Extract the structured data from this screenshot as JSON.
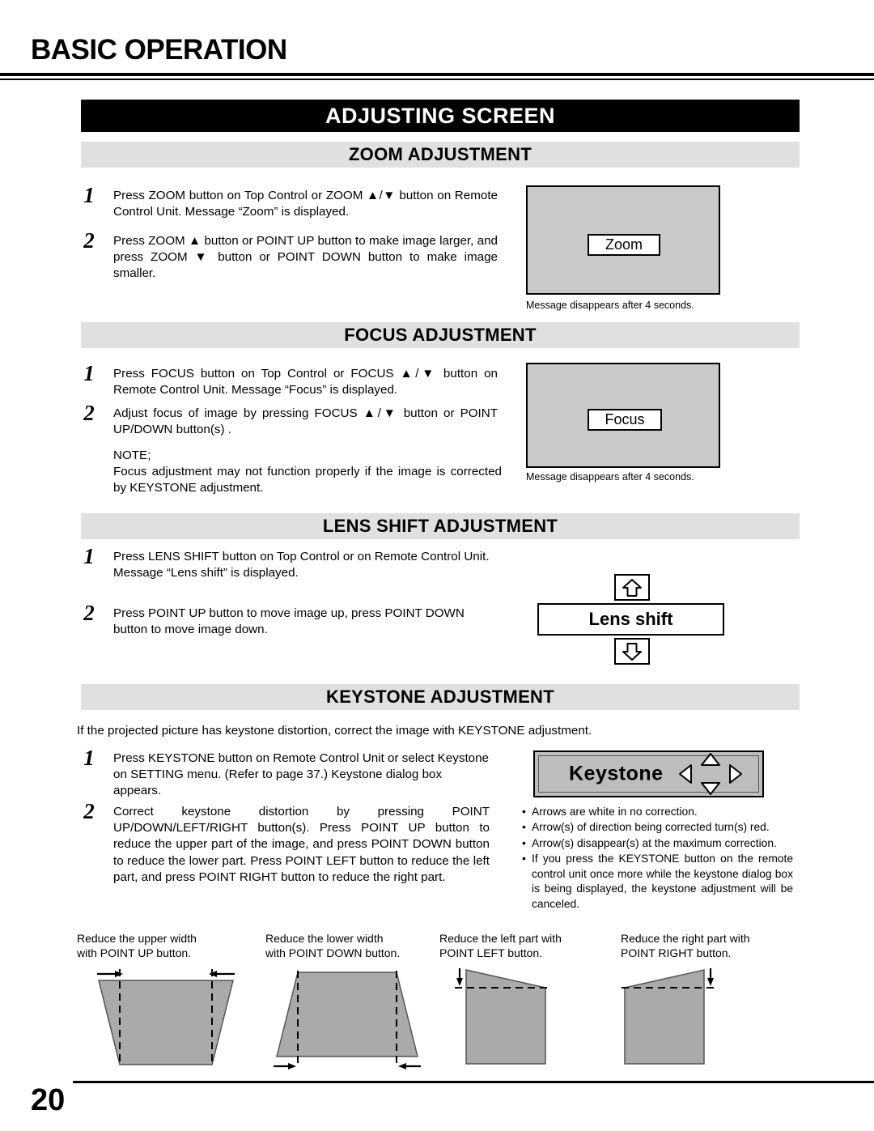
{
  "header": {
    "title": "BASIC OPERATION",
    "banner": "ADJUSTING SCREEN"
  },
  "footer": {
    "page_number": "20"
  },
  "sections": {
    "zoom": {
      "heading": "ZOOM ADJUSTMENT",
      "steps": [
        {
          "num": "1",
          "text": "Press ZOOM button on Top Control or ZOOM ▲/▼ button on Remote Control Unit.  Message “Zoom” is displayed."
        },
        {
          "num": "2",
          "text": "Press ZOOM ▲ button or POINT UP button to make image larger, and press ZOOM ▼ button or POINT DOWN button to make image smaller."
        }
      ],
      "osd_message": "Zoom",
      "caption": "Message disappears after 4 seconds."
    },
    "focus": {
      "heading": "FOCUS ADJUSTMENT",
      "steps": [
        {
          "num": "1",
          "text": "Press FOCUS button on Top Control or FOCUS ▲/▼ button on Remote Control Unit.  Message “Focus” is displayed."
        },
        {
          "num": "2",
          "text": "Adjust focus of image by pressing FOCUS ▲/▼  button or POINT UP/DOWN button(s) ."
        }
      ],
      "note_label": "NOTE;",
      "note_text": "Focus adjustment may not function properly if the image is corrected by KEYSTONE adjustment.",
      "osd_message": "Focus",
      "caption": "Message disappears after 4 seconds."
    },
    "lens_shift": {
      "heading": "LENS SHIFT ADJUSTMENT",
      "steps": [
        {
          "num": "1",
          "text": "Press LENS SHIFT button on Top Control or on Remote Control Unit. Message “Lens shift” is displayed."
        },
        {
          "num": "2",
          "text": "Press POINT UP button to move image up, press POINT DOWN button to move image down."
        }
      ],
      "osd_message": "Lens shift"
    },
    "keystone": {
      "heading": "KEYSTONE ADJUSTMENT",
      "intro": "If the projected picture has keystone distortion, correct the image with KEYSTONE adjustment.",
      "steps": [
        {
          "num": "1",
          "text": "Press KEYSTONE button on Remote Control Unit or select Keystone on SETTING menu.  (Refer to page 37.)  Keystone dialog box appears."
        },
        {
          "num": "2",
          "text": "Correct keystone distortion by pressing POINT UP/DOWN/LEFT/RIGHT button(s).  Press POINT UP button to reduce the upper part of the image, and press POINT DOWN button to reduce the lower part.  Press POINT LEFT button to reduce the left part, and press POINT RIGHT button to reduce the right part."
        }
      ],
      "dialog_label": "Keystone",
      "bullets": [
        "Arrows are white in no correction.",
        "Arrow(s) of direction being corrected turn(s) red.",
        "Arrow(s) disappear(s) at the maximum correction.",
        "If you press the KEYSTONE button on the remote control unit once more while the keystone dialog box is being displayed, the keystone adjustment will be canceled."
      ]
    }
  },
  "diagrams": [
    {
      "line1": "Reduce the upper width",
      "line2": "with POINT UP button."
    },
    {
      "line1": "Reduce the lower width",
      "line2": "with POINT DOWN button."
    },
    {
      "line1": "Reduce the left part with",
      "line2": "POINT LEFT button."
    },
    {
      "line1": "Reduce the right part with",
      "line2": "POINT RIGHT button."
    }
  ],
  "colors": {
    "banner_bg": "#000000",
    "section_bar_bg": "#e0e0e0",
    "osd_screen_bg": "#c9c9c9",
    "dialog_bg": "#bdbdbd",
    "shape_fill": "#aaaaaa"
  }
}
